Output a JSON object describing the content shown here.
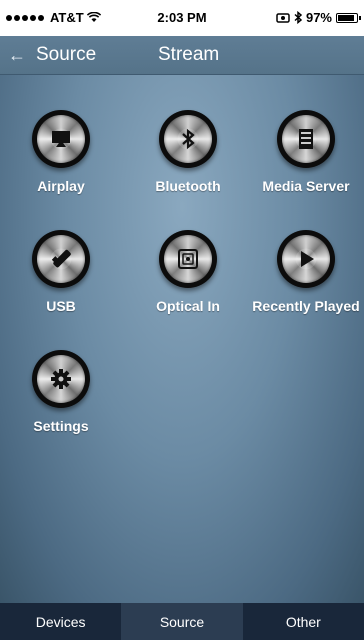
{
  "status": {
    "carrier": "AT&T",
    "time": "2:03 PM",
    "battery": "97%",
    "battery_level": 0.97
  },
  "nav": {
    "back_label": "Source",
    "title": "Stream"
  },
  "sources": [
    {
      "label": "Airplay",
      "icon": "airplay-icon"
    },
    {
      "label": "Bluetooth",
      "icon": "bluetooth-icon"
    },
    {
      "label": "Media Server",
      "icon": "media-server-icon"
    },
    {
      "label": "USB",
      "icon": "usb-icon"
    },
    {
      "label": "Optical In",
      "icon": "optical-in-icon"
    },
    {
      "label": "Recently Played",
      "icon": "play-icon"
    },
    {
      "label": "Settings",
      "icon": "gear-icon"
    }
  ],
  "tabs": [
    {
      "label": "Devices",
      "active": false
    },
    {
      "label": "Source",
      "active": true
    },
    {
      "label": "Other",
      "active": false
    }
  ],
  "colors": {
    "tab_bar": "#19273a",
    "tab_active": "#2c3d52",
    "background": "#6b8ba4"
  }
}
